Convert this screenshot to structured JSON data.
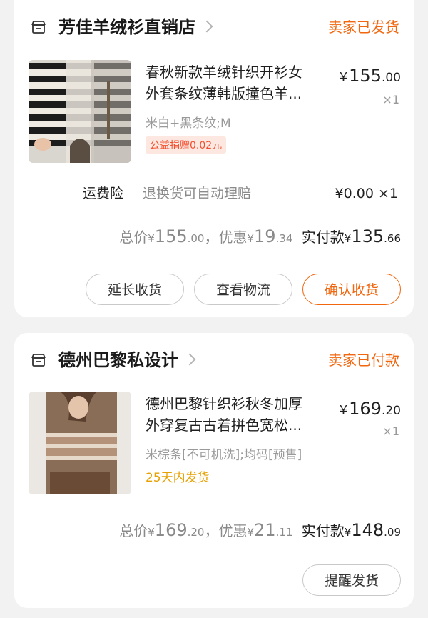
{
  "orders": [
    {
      "shop_name": "芳佳羊绒衫直销店",
      "status": "卖家已发货",
      "item": {
        "title_line1": "春秋新款羊绒针织开衫女",
        "title_line2": "外套条纹薄韩版撞色羊...",
        "spec": "米白+黑条纹;M",
        "badge": "公益捐赠0.02元",
        "price_currency": "¥",
        "price_int": "155",
        "price_dec": ".00",
        "qty": "×1"
      },
      "insurance": {
        "label": "运费险",
        "desc": "退换货可自动理赔",
        "price": "¥0.00 ×1"
      },
      "totals": {
        "total_label": "总价",
        "total_cur": "¥",
        "total_int": "155",
        "total_dec": ".00",
        "sep": "，",
        "discount_label": "优惠",
        "discount_cur": "¥",
        "discount_int": "19",
        "discount_dec": ".34",
        "paid_label": "实付款",
        "paid_cur": "¥",
        "paid_int": "135",
        "paid_dec": ".66"
      },
      "buttons": {
        "extend": "延长收货",
        "logistics": "查看物流",
        "confirm": "确认收货"
      }
    },
    {
      "shop_name": "德州巴黎私设计",
      "status": "卖家已付款",
      "item": {
        "title_line1": "德州巴黎针织衫秋冬加厚",
        "title_line2": "外穿复古古着拼色宽松...",
        "spec": "米棕条[不可机洗];均码[预售]",
        "ship_note": "25天内发货",
        "price_currency": "¥",
        "price_int": "169",
        "price_dec": ".20",
        "qty": "×1"
      },
      "totals": {
        "total_label": "总价",
        "total_cur": "¥",
        "total_int": "169",
        "total_dec": ".20",
        "sep": "，",
        "discount_label": "优惠",
        "discount_cur": "¥",
        "discount_int": "21",
        "discount_dec": ".11",
        "paid_label": "实付款",
        "paid_cur": "¥",
        "paid_int": "148",
        "paid_dec": ".09"
      },
      "buttons": {
        "remind": "提醒发货"
      }
    }
  ],
  "colors": {
    "accent": "#f2660d",
    "badge_red": "#f24e2c",
    "ship_yellow": "#e6a100"
  },
  "icons": [
    "store-icon",
    "chevron-right-icon"
  ]
}
